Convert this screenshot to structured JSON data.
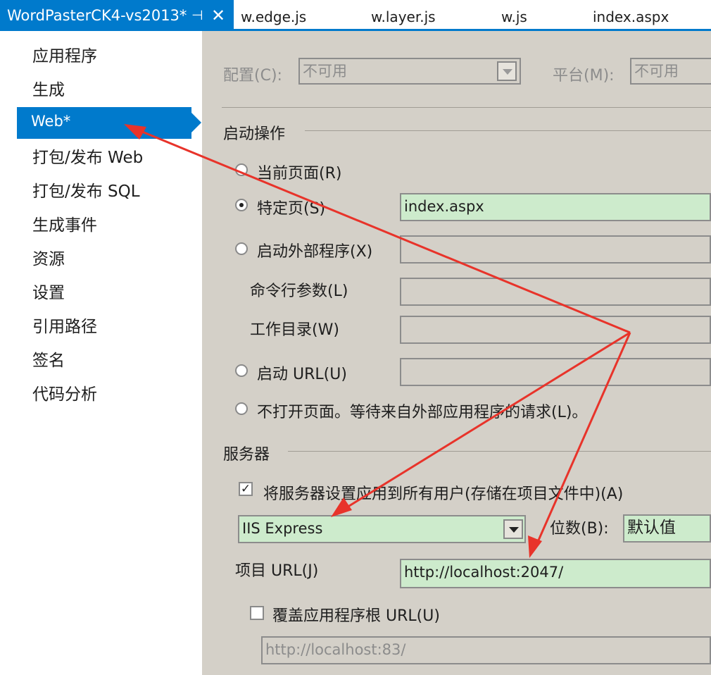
{
  "tabs": {
    "active": "WordPasterCK4-vs2013*",
    "pin": "⊣",
    "close": "✕",
    "others": [
      "w.edge.js",
      "w.layer.js",
      "w.js",
      "index.aspx"
    ]
  },
  "sidebar": {
    "items": [
      "应用程序",
      "生成",
      "Web*",
      "打包/发布 Web",
      "打包/发布 SQL",
      "生成事件",
      "资源",
      "设置",
      "引用路径",
      "签名",
      "代码分析"
    ],
    "selected": "Web*"
  },
  "config": {
    "config_label": "配置(C):",
    "config_value": "不可用",
    "platform_label": "平台(M):",
    "platform_value": "不可用"
  },
  "start": {
    "section": "启动操作",
    "current_page": "当前页面(R)",
    "specific_page": "特定页(S)",
    "specific_page_value": "index.aspx",
    "external": "启动外部程序(X)",
    "cmd_args": "命令行参数(L)",
    "work_dir": "工作目录(W)",
    "start_url": "启动 URL(U)",
    "dont_open": "不打开页面。等待来自外部应用程序的请求(L)。"
  },
  "server": {
    "section": "服务器",
    "apply_all": "将服务器设置应用到所有用户(存储在项目文件中)(A)",
    "server_value": "IIS Express",
    "bitness_label": "位数(B):",
    "bitness_value": "默认值",
    "project_url_label": "项目 URL(J)",
    "project_url_value": "http://localhost:2047/",
    "override_label": "覆盖应用程序根 URL(U)",
    "override_value": "http://localhost:83/"
  },
  "colors": {
    "accent": "#007acc",
    "panel": "#d4d0c8",
    "green_field": "#cdebcc",
    "arrow": "#e8332a"
  }
}
